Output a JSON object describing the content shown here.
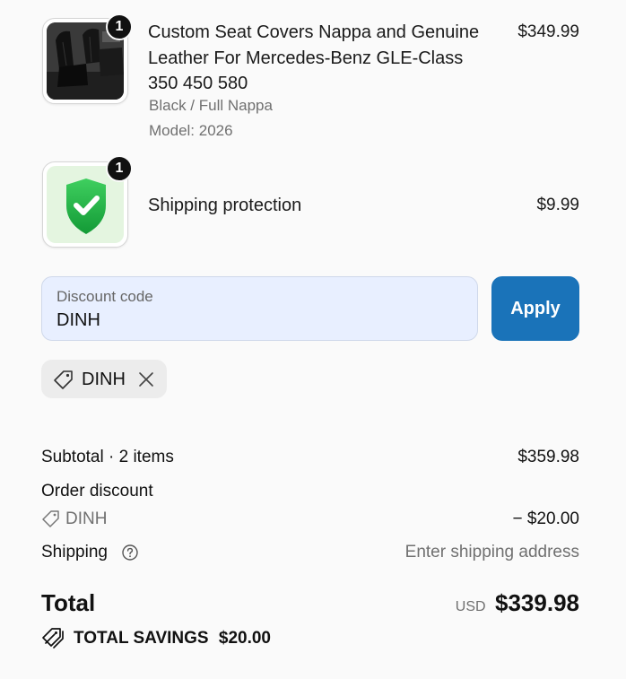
{
  "items": [
    {
      "title": "Custom Seat Covers Nappa and Genuine Leather For Mercedes-Benz GLE-Class 350 450 580",
      "title_lines": [
        "Custom Seat Covers Nappa and Genuine",
        "Leather For Mercedes-Benz GLE-Class",
        "350 450 580"
      ],
      "variant": "Black / Full Nappa",
      "model": "Model: 2026",
      "quantity": "1",
      "price": "$349.99",
      "thumbnail_icon": "car-seat-image"
    },
    {
      "title": "Shipping protection",
      "quantity": "1",
      "price": "$9.99",
      "thumbnail_icon": "shield-check-icon"
    }
  ],
  "discount": {
    "label": "Discount code",
    "value": "DINH",
    "apply_label": "Apply",
    "applied_code": "DINH"
  },
  "summary": {
    "subtotal_label": "Subtotal · 2 items",
    "subtotal_value": "$359.98",
    "order_discount_label": "Order discount",
    "order_discount_code": "DINH",
    "order_discount_value": "− $20.00",
    "shipping_label": "Shipping",
    "shipping_value": "Enter shipping address",
    "total_label": "Total",
    "currency": "USD",
    "total_value": "$339.98",
    "savings_label": "TOTAL SAVINGS",
    "savings_value": "$20.00"
  },
  "colors": {
    "apply_button": "#1a73b9",
    "discount_field_bg": "#e8efff",
    "shield_green": "#22b14c"
  }
}
